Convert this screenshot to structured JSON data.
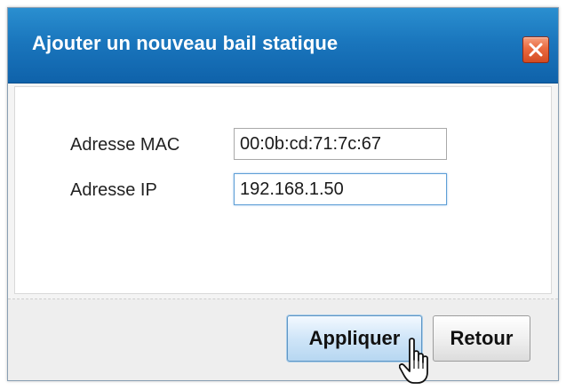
{
  "dialog": {
    "title": "Ajouter un nouveau bail statique",
    "close_icon": "close-icon"
  },
  "form": {
    "mac": {
      "label": "Adresse MAC",
      "value": "00:0b:cd:71:7c:67"
    },
    "ip": {
      "label": "Adresse IP",
      "value": "192.168.1.50"
    }
  },
  "footer": {
    "apply_label": "Appliquer",
    "back_label": "Retour"
  },
  "colors": {
    "titlebar": "#1a76bd",
    "close_button": "#e96a3f",
    "apply_button": "#cfe5f8"
  },
  "icons": {
    "close": "close-icon",
    "cursor": "hand-pointer-icon"
  }
}
